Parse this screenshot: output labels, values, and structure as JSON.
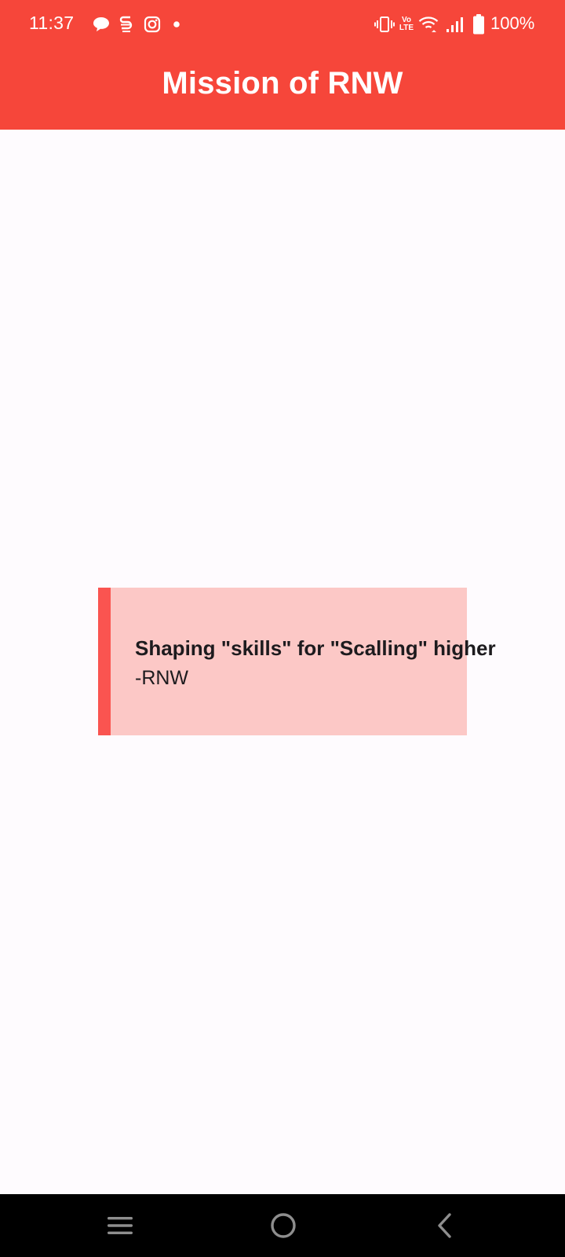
{
  "status_bar": {
    "time": "11:37",
    "battery": "100%",
    "notification_icons": [
      "chat-bubble-icon",
      "s-app-icon",
      "instagram-icon",
      "dot-icon"
    ],
    "system_icons": [
      "vibrate-icon",
      "volte-icon",
      "wifi-icon",
      "signal-icon",
      "battery-icon"
    ],
    "volte_label": "Vo LTE"
  },
  "app_bar": {
    "title": "Mission of RNW"
  },
  "card": {
    "quote": "Shaping \"skills\" for \"Scalling\" higher",
    "author": "-RNW"
  },
  "nav_bar": {
    "buttons": [
      "recents-icon",
      "home-icon",
      "back-icon"
    ]
  },
  "colors": {
    "app_bar": "#f6463a",
    "background": "#fefbfe",
    "card_background": "#fcc8c6",
    "card_accent": "#fa5450",
    "text": "#1d1b1e",
    "nav_bar": "#000000"
  }
}
